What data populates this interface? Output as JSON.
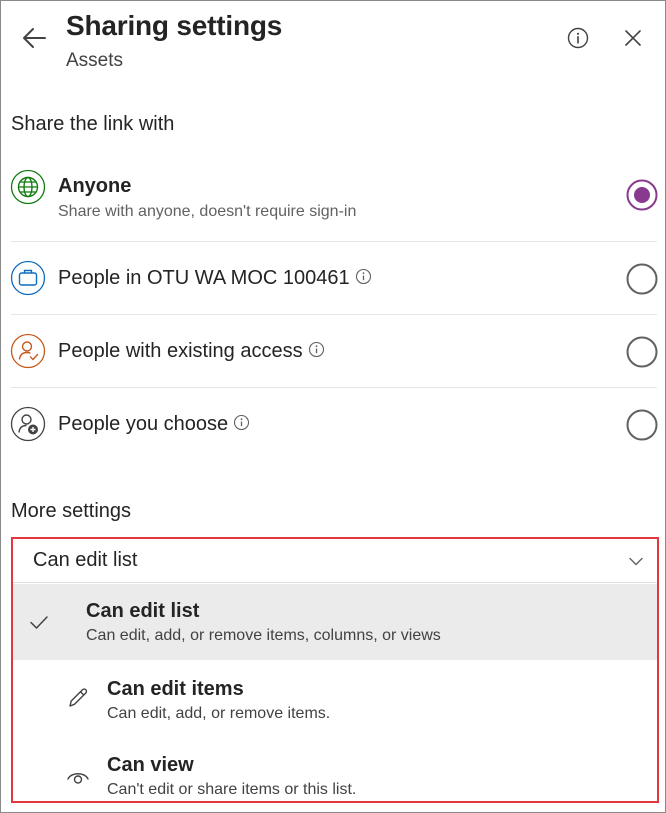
{
  "header": {
    "title": "Sharing settings",
    "subtitle": "Assets",
    "back_icon": "back-arrow-icon",
    "info_icon": "info-icon",
    "close_icon": "close-icon"
  },
  "share_section": {
    "title": "Share the link with",
    "options": [
      {
        "label": "Anyone",
        "description": "Share with anyone, doesn't require sign-in",
        "icon": "globe-icon",
        "selected": true
      },
      {
        "label": "People in OTU WA MOC 100461",
        "icon": "briefcase-icon",
        "info": true,
        "selected": false
      },
      {
        "label": "People with existing access",
        "icon": "person-check-icon",
        "info": true,
        "selected": false
      },
      {
        "label": "People you choose",
        "icon": "person-add-icon",
        "info": true,
        "selected": false
      }
    ]
  },
  "more_settings": {
    "title": "More settings",
    "permission": {
      "value": "Can edit list",
      "options": [
        {
          "label": "Can edit list",
          "description": "Can edit, add, or remove items, columns, or views",
          "icon": "checkmark-icon",
          "selected": true
        },
        {
          "label": "Can edit items",
          "description": "Can edit, add, or remove items.",
          "icon": "pencil-icon",
          "selected": false
        },
        {
          "label": "Can view",
          "description": "Can't edit or share items or this list.",
          "icon": "eye-icon",
          "selected": false
        }
      ]
    }
  },
  "colors": {
    "accent": "#8a3a8e",
    "highlight_border": "#e2373e",
    "globe": "#107c10",
    "briefcase": "#0f6cbd",
    "person_existing": "#c55a1c",
    "selected_item_bg": "#ebebeb"
  }
}
